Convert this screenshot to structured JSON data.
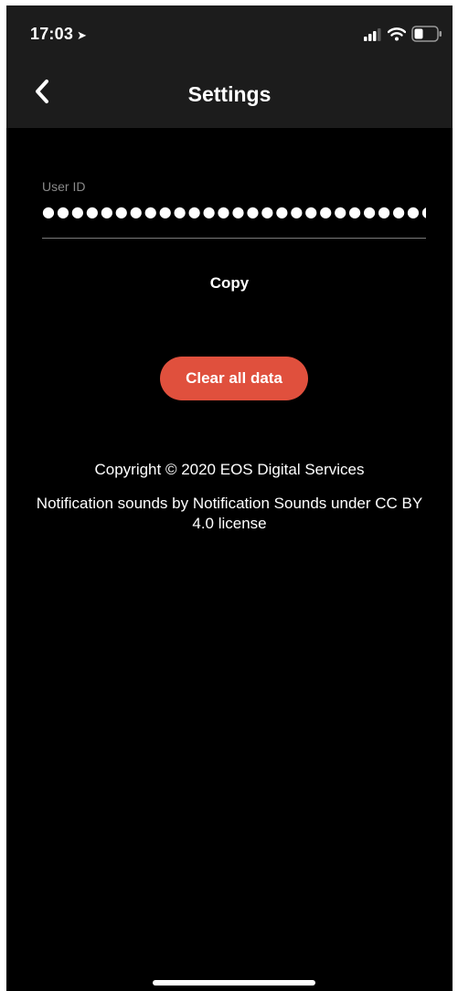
{
  "status_bar": {
    "time": "17:03",
    "location_icon": "location-arrow-icon",
    "signal_icon": "cellular-signal-icon",
    "wifi_icon": "wifi-icon",
    "battery_icon": "battery-icon"
  },
  "nav": {
    "title": "Settings",
    "back_icon": "chevron-left-icon"
  },
  "user_id_field": {
    "label": "User ID",
    "value": "●●●●●●●●●●●●●●●●●●●●●●●●●●●●"
  },
  "actions": {
    "copy_label": "Copy",
    "clear_label": "Clear all data"
  },
  "footer": {
    "copyright": "Copyright © 2020 EOS Digital Services",
    "credits": "Notification sounds by Notification Sounds under CC BY 4.0 license"
  },
  "colors": {
    "background": "#000000",
    "bar_background": "#1c1c1c",
    "accent_button": "#e0503d",
    "text": "#ffffff",
    "muted_text": "#8a8a8a"
  }
}
